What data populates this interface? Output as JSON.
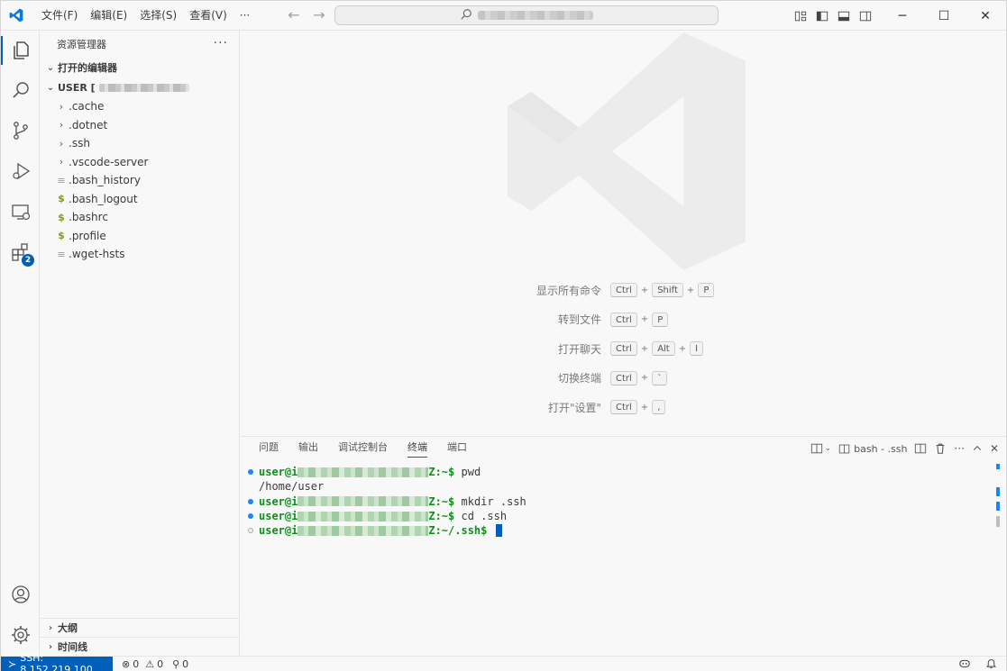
{
  "titlebar": {
    "menus": [
      "文件(F)",
      "编辑(E)",
      "选择(S)",
      "查看(V)",
      "···"
    ],
    "search_text": "",
    "accent": "#005fb8"
  },
  "activity": {
    "items": [
      "explorer-icon",
      "search-icon",
      "source-control-icon",
      "run-debug-icon",
      "remote-explorer-icon",
      "extensions-icon"
    ],
    "extensions_badge": "2",
    "bottom": [
      "account-icon",
      "settings-gear-icon"
    ]
  },
  "sidebar": {
    "title": "资源管理器",
    "more": "···",
    "open_editors": "打开的编辑器",
    "root_label": "USER [",
    "tree": [
      {
        "label": ".cache",
        "kind": "folder"
      },
      {
        "label": ".dotnet",
        "kind": "folder"
      },
      {
        "label": ".ssh",
        "kind": "folder"
      },
      {
        "label": ".vscode-server",
        "kind": "folder"
      },
      {
        "label": ".bash_history",
        "kind": "text"
      },
      {
        "label": ".bash_logout",
        "kind": "shell"
      },
      {
        "label": ".bashrc",
        "kind": "shell"
      },
      {
        "label": ".profile",
        "kind": "shell"
      },
      {
        "label": ".wget-hsts",
        "kind": "text"
      }
    ],
    "outline": "大纲",
    "timeline": "时间线"
  },
  "editor": {
    "shortcuts": [
      {
        "label": "显示所有命令",
        "keys": [
          "Ctrl",
          "Shift",
          "P"
        ]
      },
      {
        "label": "转到文件",
        "keys": [
          "Ctrl",
          "P"
        ]
      },
      {
        "label": "打开聊天",
        "keys": [
          "Ctrl",
          "Alt",
          "I"
        ]
      },
      {
        "label": "切换终端",
        "keys": [
          "Ctrl",
          "`"
        ]
      },
      {
        "label": "打开\"设置\"",
        "keys": [
          "Ctrl",
          ","
        ]
      }
    ]
  },
  "panel": {
    "tabs": [
      "问题",
      "输出",
      "调试控制台",
      "终端",
      "端口"
    ],
    "active_tab": "终端",
    "terminal_name": "bash - .ssh",
    "more": "···",
    "lines": [
      {
        "dot": "filled",
        "user": "user@i",
        "suffix": "Z:~$",
        "cmd": " pwd"
      },
      {
        "dot": "none",
        "output": "/home/user"
      },
      {
        "dot": "filled",
        "user": "user@i",
        "suffix": "Z:~$",
        "cmd": " mkdir .ssh"
      },
      {
        "dot": "filled",
        "user": "user@i",
        "suffix": "Z:~$",
        "cmd": " cd .ssh"
      },
      {
        "dot": "empty",
        "user": "user@i",
        "suffix": "Z:~/.ssh$",
        "cmd": " "
      }
    ]
  },
  "statusbar": {
    "remote": "SSH: 8.152.219.100",
    "errors": "0",
    "warnings": "0",
    "ports": "0"
  }
}
